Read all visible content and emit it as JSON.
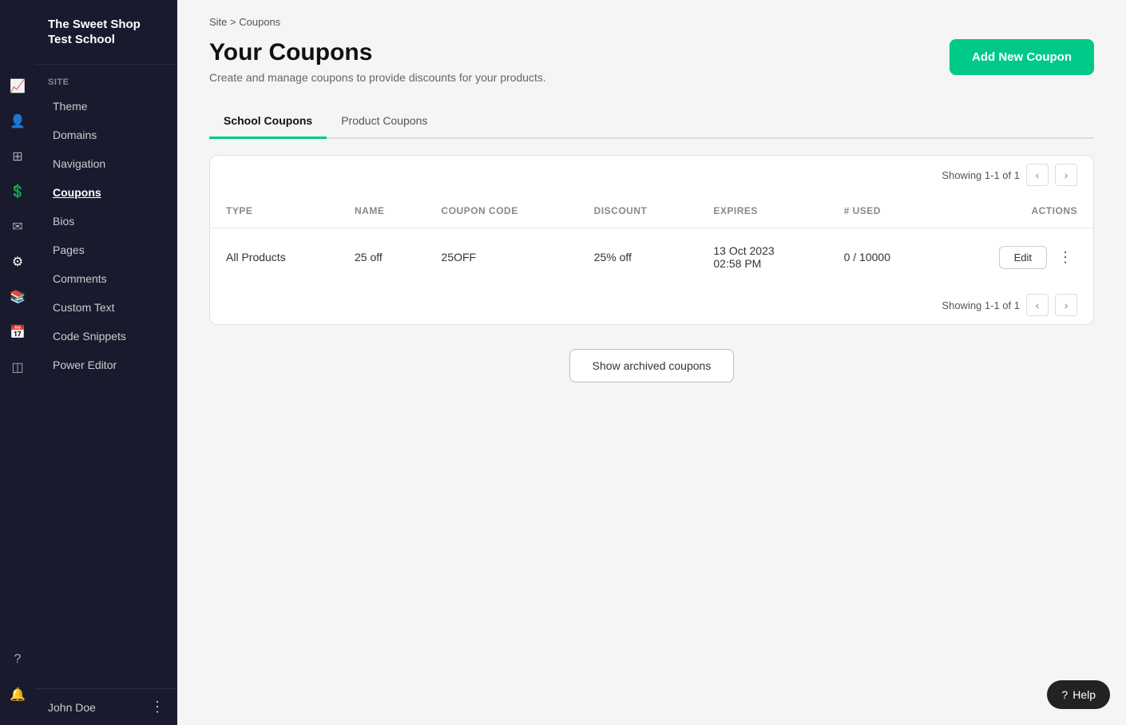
{
  "school": {
    "name": "The Sweet Shop Test School"
  },
  "sidebar": {
    "section_label": "SITE",
    "items": [
      {
        "id": "theme",
        "label": "Theme",
        "active": false
      },
      {
        "id": "domains",
        "label": "Domains",
        "active": false
      },
      {
        "id": "navigation",
        "label": "Navigation",
        "active": false
      },
      {
        "id": "coupons",
        "label": "Coupons",
        "active": true
      },
      {
        "id": "bios",
        "label": "Bios",
        "active": false
      },
      {
        "id": "pages",
        "label": "Pages",
        "active": false
      },
      {
        "id": "comments",
        "label": "Comments",
        "active": false
      },
      {
        "id": "custom-text",
        "label": "Custom Text",
        "active": false
      },
      {
        "id": "code-snippets",
        "label": "Code Snippets",
        "active": false
      },
      {
        "id": "power-editor",
        "label": "Power Editor",
        "active": false
      }
    ],
    "user": {
      "name": "John Doe"
    }
  },
  "breadcrumb": {
    "site": "Site",
    "separator": ">",
    "current": "Coupons"
  },
  "page": {
    "title": "Your Coupons",
    "subtitle": "Create and manage coupons to provide discounts for your products.",
    "add_button_label": "Add New Coupon"
  },
  "tabs": [
    {
      "id": "school-coupons",
      "label": "School Coupons",
      "active": true
    },
    {
      "id": "product-coupons",
      "label": "Product Coupons",
      "active": false
    }
  ],
  "table": {
    "pagination_top": "Showing 1-1 of 1",
    "pagination_bottom": "Showing 1-1 of 1",
    "columns": [
      {
        "id": "type",
        "label": "TYPE"
      },
      {
        "id": "name",
        "label": "NAME"
      },
      {
        "id": "coupon-code",
        "label": "COUPON CODE"
      },
      {
        "id": "discount",
        "label": "DISCOUNT"
      },
      {
        "id": "expires",
        "label": "EXPIRES"
      },
      {
        "id": "used",
        "label": "# USED"
      },
      {
        "id": "actions",
        "label": "ACTIONS"
      }
    ],
    "rows": [
      {
        "type": "All Products",
        "name": "25 off",
        "coupon_code": "25OFF",
        "discount": "25% off",
        "expires_line1": "13 Oct 2023",
        "expires_line2": "02:58 PM",
        "used": "0 / 10000",
        "edit_label": "Edit"
      }
    ]
  },
  "archive": {
    "button_label": "Show archived coupons"
  },
  "help": {
    "label": "Help"
  },
  "icons": {
    "chart": "📈",
    "person": "👤",
    "dashboard": "⊞",
    "dollar": "💲",
    "mail": "✉",
    "gear": "⚙",
    "book": "📚",
    "calendar": "📅",
    "layers": "◫",
    "question": "?",
    "bell": "🔔",
    "prev": "‹",
    "next": "›",
    "more": "⋮"
  }
}
